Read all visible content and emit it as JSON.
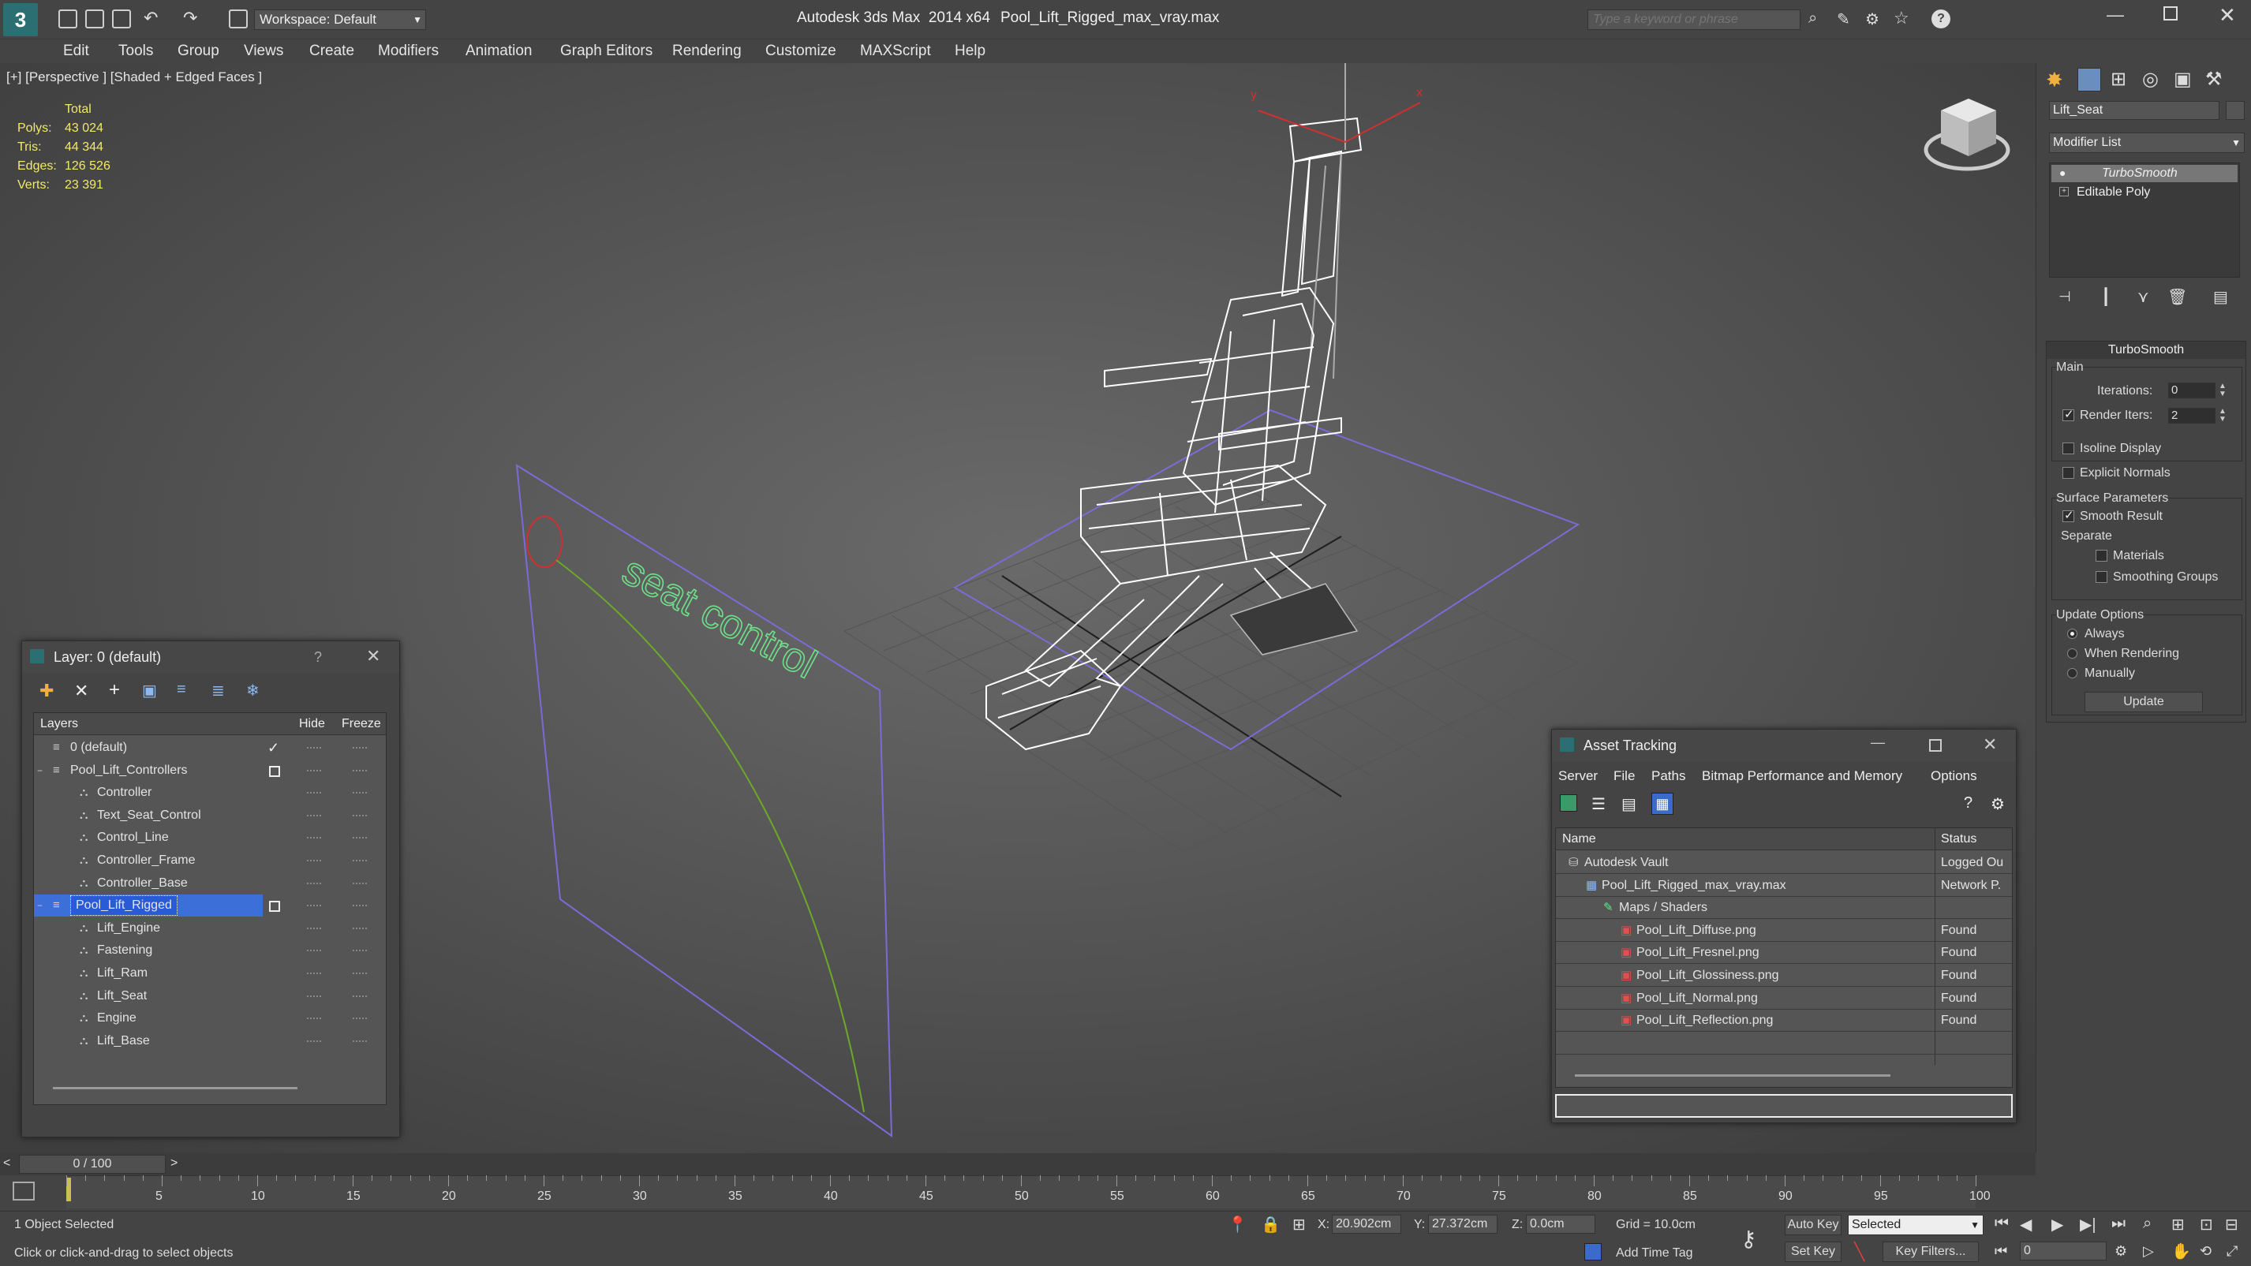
{
  "titlebar": {
    "workspace": "Workspace: Default",
    "app_title": "Autodesk 3ds Max  2014 x64",
    "file_title": "Pool_Lift_Rigged_max_vray.max",
    "search_placeholder": "Type a keyword or phrase"
  },
  "menu": [
    "Edit",
    "Tools",
    "Group",
    "Views",
    "Create",
    "Modifiers",
    "Animation",
    "Graph Editors",
    "Rendering",
    "Customize",
    "MAXScript",
    "Help"
  ],
  "viewport": {
    "label": "[+] [Perspective ] [Shaded + Edged Faces ]",
    "stats_header": "Total",
    "stats": [
      {
        "label": "Polys:",
        "value": "43 024"
      },
      {
        "label": "Tris:",
        "value": "44 344"
      },
      {
        "label": "Edges:",
        "value": "126 526"
      },
      {
        "label": "Verts:",
        "value": "23 391"
      }
    ],
    "scene_text": "seat control"
  },
  "command_panel": {
    "object_name": "Lift_Seat",
    "modifier_list": "Modifier List",
    "stack": [
      "TurboSmooth",
      "Editable Poly"
    ],
    "rollout_title": "TurboSmooth",
    "main_label": "Main",
    "iterations_label": "Iterations:",
    "iterations_value": "0",
    "render_iters_label": "Render Iters:",
    "render_iters_value": "2",
    "render_iters_checked": true,
    "isoline_label": "Isoline Display",
    "explicit_normals_label": "Explicit Normals",
    "surface_params_label": "Surface Parameters",
    "smooth_result_label": "Smooth Result",
    "separate_label": "Separate",
    "materials_label": "Materials",
    "smoothing_groups_label": "Smoothing Groups",
    "update_options_label": "Update Options",
    "update_options": [
      "Always",
      "When Rendering",
      "Manually"
    ],
    "update_selected": "Always",
    "update_button": "Update"
  },
  "layer_window": {
    "title": "Layer: 0 (default)",
    "help": "?",
    "col_layers": "Layers",
    "col_hide": "Hide",
    "col_freeze": "Freeze",
    "rows": [
      {
        "name": "0 (default)",
        "level": 0,
        "type": "layer",
        "checked": true
      },
      {
        "name": "Pool_Lift_Controllers",
        "level": 0,
        "type": "layer",
        "box": true
      },
      {
        "name": "Controller",
        "level": 1,
        "type": "object"
      },
      {
        "name": "Text_Seat_Control",
        "level": 1,
        "type": "object"
      },
      {
        "name": "Control_Line",
        "level": 1,
        "type": "object"
      },
      {
        "name": "Controller_Frame",
        "level": 1,
        "type": "object"
      },
      {
        "name": "Controller_Base",
        "level": 1,
        "type": "object"
      },
      {
        "name": "Pool_Lift_Rigged",
        "level": 0,
        "type": "layer",
        "box": true,
        "selected": true
      },
      {
        "name": "Lift_Engine",
        "level": 1,
        "type": "object"
      },
      {
        "name": "Fastening",
        "level": 1,
        "type": "object"
      },
      {
        "name": "Lift_Ram",
        "level": 1,
        "type": "object"
      },
      {
        "name": "Lift_Seat",
        "level": 1,
        "type": "object"
      },
      {
        "name": "Engine",
        "level": 1,
        "type": "object"
      },
      {
        "name": "Lift_Base",
        "level": 1,
        "type": "object"
      }
    ]
  },
  "asset_window": {
    "title": "Asset Tracking",
    "menu": [
      "Server",
      "File",
      "Paths",
      "Bitmap Performance and Memory",
      "Options"
    ],
    "col_name": "Name",
    "col_status": "Status",
    "rows": [
      {
        "name": "Autodesk Vault",
        "status": "Logged Ou",
        "level": 1,
        "icon": "vault-icon"
      },
      {
        "name": "Pool_Lift_Rigged_max_vray.max",
        "status": "Network P.",
        "level": 2,
        "icon": "max-file-icon"
      },
      {
        "name": "Maps / Shaders",
        "status": "",
        "level": 3,
        "icon": "maps-icon"
      },
      {
        "name": "Pool_Lift_Diffuse.png",
        "status": "Found",
        "level": 4,
        "icon": "png-icon"
      },
      {
        "name": "Pool_Lift_Fresnel.png",
        "status": "Found",
        "level": 4,
        "icon": "png-icon"
      },
      {
        "name": "Pool_Lift_Glossiness.png",
        "status": "Found",
        "level": 4,
        "icon": "png-icon"
      },
      {
        "name": "Pool_Lift_Normal.png",
        "status": "Found",
        "level": 4,
        "icon": "png-icon"
      },
      {
        "name": "Pool_Lift_Reflection.png",
        "status": "Found",
        "level": 4,
        "icon": "png-icon"
      }
    ]
  },
  "timeline": {
    "frame_display": "0 / 100",
    "ticks": [
      "5",
      "10",
      "15",
      "20",
      "25",
      "30",
      "35",
      "40",
      "45",
      "50",
      "55",
      "60",
      "65",
      "70",
      "75",
      "80",
      "85",
      "90",
      "95",
      "100"
    ]
  },
  "status": {
    "selection": "1 Object Selected",
    "prompt": "Click or click-and-drag to select objects",
    "x_label": "X:",
    "x_value": "20.902cm",
    "y_label": "Y:",
    "y_value": "27.372cm",
    "z_label": "Z:",
    "z_value": "0.0cm",
    "grid": "Grid = 10.0cm",
    "add_time_tag": "Add Time Tag",
    "auto_key": "Auto Key",
    "set_key": "Set Key",
    "key_mode": "Selected",
    "key_filters": "Key Filters...",
    "frame_value": "0"
  },
  "colors": {
    "selection": "#2a5bd7",
    "stats": "#f2e96a",
    "wire": "#ffffff",
    "frame": "#7b6bd6",
    "text_3d": "#6fe08a"
  }
}
